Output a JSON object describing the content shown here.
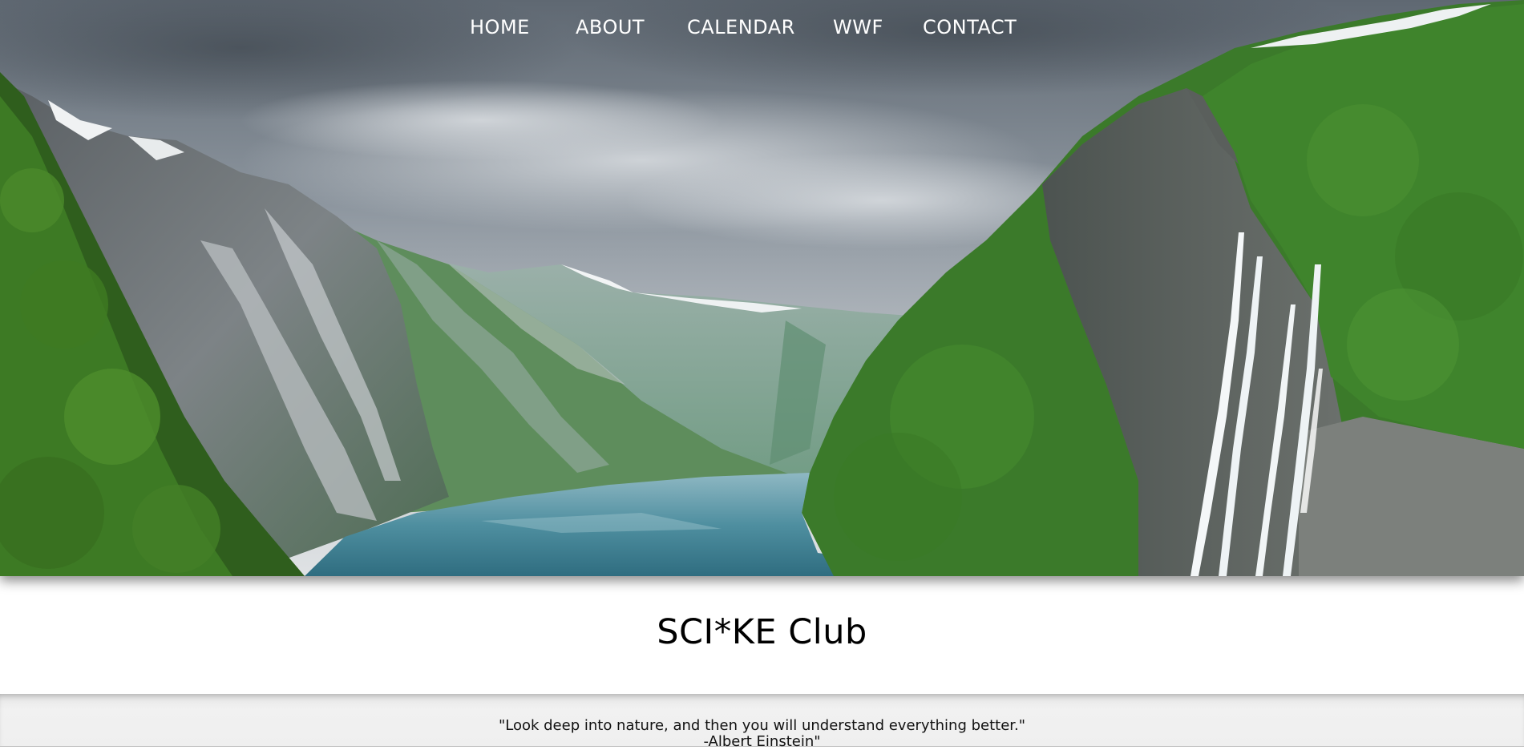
{
  "nav": {
    "items": [
      {
        "label": "HOME",
        "name": "nav-home"
      },
      {
        "label": "ABOUT",
        "name": "nav-about"
      },
      {
        "label": "CALENDAR",
        "name": "nav-calendar"
      },
      {
        "label": "WWF",
        "name": "nav-wwf"
      },
      {
        "label": "CONTACT",
        "name": "nav-contact"
      }
    ]
  },
  "hero": {
    "image": "fjord-landscape-with-waterfalls"
  },
  "main": {
    "title": "SCI*KE Club"
  },
  "quote": {
    "text": "\"Look deep into nature, and then you will understand everything better.\"",
    "author": "-Albert Einstein\""
  },
  "colors": {
    "nav_text": "#ffffff",
    "title_text": "#000000",
    "quote_bar": "#efefef",
    "water": "#3f8a9c",
    "forest": "#3d7a2e"
  }
}
